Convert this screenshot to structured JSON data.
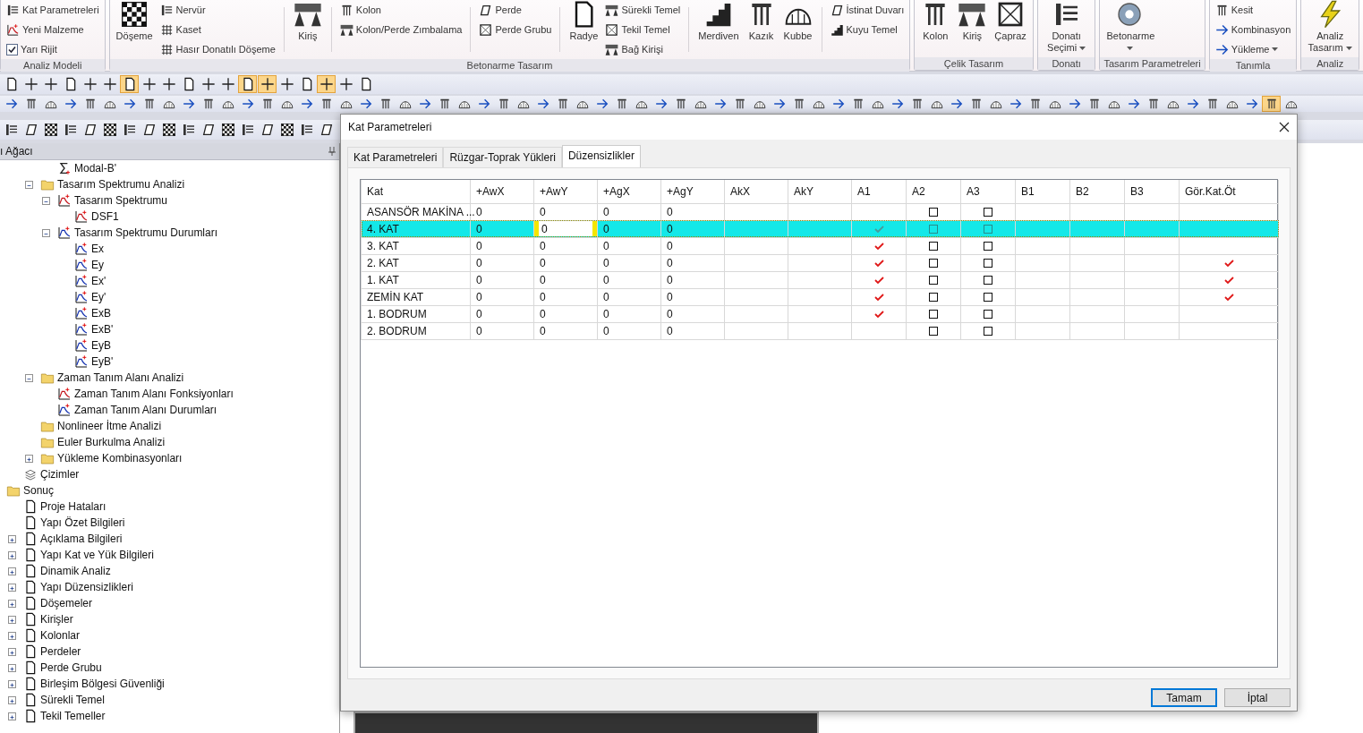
{
  "ribbon": {
    "groups": [
      {
        "label": "Analiz Modeli",
        "items": [
          {
            "kind": "stack",
            "items": [
              {
                "label": "Kat Parametreleri"
              },
              {
                "label": "Yeni Malzeme"
              },
              {
                "label": "Yarı Rijit",
                "checked": true
              }
            ]
          }
        ]
      },
      {
        "label": "Betonarme Tasarım",
        "items": [
          {
            "kind": "large",
            "label": "Döşeme"
          },
          {
            "kind": "stack",
            "items": [
              {
                "label": "Nervür"
              },
              {
                "label": "Kaset"
              },
              {
                "label": "Hasır Donatılı Döşeme"
              }
            ]
          },
          {
            "kind": "separator"
          },
          {
            "kind": "large",
            "label": "Kiriş"
          },
          {
            "kind": "separator"
          },
          {
            "kind": "stack",
            "items": [
              {
                "label": "Kolon"
              },
              {
                "label": "Kolon/Perde Zımbalama"
              }
            ]
          },
          {
            "kind": "separator"
          },
          {
            "kind": "stack",
            "items": [
              {
                "label": "Perde"
              },
              {
                "label": "Perde Grubu"
              }
            ]
          },
          {
            "kind": "separator"
          },
          {
            "kind": "large",
            "label": "Radye"
          },
          {
            "kind": "stack",
            "items": [
              {
                "label": "Sürekli Temel"
              },
              {
                "label": "Tekil Temel"
              },
              {
                "label": "Bağ Kirişi"
              }
            ]
          },
          {
            "kind": "separator"
          },
          {
            "kind": "large",
            "label": "Merdiven"
          },
          {
            "kind": "large",
            "label": "Kazık"
          },
          {
            "kind": "large",
            "label": "Kubbe"
          },
          {
            "kind": "separator"
          },
          {
            "kind": "stack",
            "items": [
              {
                "label": "İstinat Duvarı"
              },
              {
                "label": "Kuyu Temel"
              }
            ]
          }
        ]
      },
      {
        "label": "Çelik Tasarım",
        "items": [
          {
            "kind": "large",
            "label": "Kolon"
          },
          {
            "kind": "large",
            "label": "Kiriş"
          },
          {
            "kind": "large",
            "label": "Çapraz"
          }
        ]
      },
      {
        "label": "Donatı",
        "items": [
          {
            "kind": "large",
            "label": "Donatı Seçimi",
            "dropdown": true
          }
        ]
      },
      {
        "label": "Tasarım Parametreleri",
        "items": [
          {
            "kind": "large",
            "label": "Betonarme",
            "dropdown": true
          }
        ]
      },
      {
        "label": "Tanımla",
        "items": [
          {
            "kind": "stack",
            "items": [
              {
                "label": "Kesit"
              },
              {
                "label": "Kombinasyon"
              },
              {
                "label": "Yükleme",
                "dropdown": true
              }
            ]
          }
        ]
      },
      {
        "label": "Analiz",
        "items": [
          {
            "kind": "large",
            "label": "Analiz Tasarım",
            "dropdown": true
          }
        ]
      }
    ]
  },
  "toolbars": [
    {
      "buttons": [
        {
          "selected": false
        },
        {
          "selected": false
        },
        {
          "selected": false
        },
        {
          "selected": false
        },
        {
          "selected": false
        },
        {
          "selected": false
        },
        {
          "selected": true
        },
        {
          "selected": false
        },
        {
          "selected": false
        },
        {
          "selected": false
        },
        {
          "selected": false
        },
        {
          "selected": false
        },
        {
          "selected": true
        },
        {
          "selected": true
        },
        {
          "selected": false
        },
        {
          "selected": false
        },
        {
          "selected": true
        },
        {
          "selected": false
        },
        {
          "selected": false
        }
      ]
    },
    {
      "buttons": [
        {
          "selected": false
        },
        {
          "selected": false
        },
        {
          "selected": false
        },
        {
          "selected": false
        },
        {
          "selected": false
        },
        {
          "selected": false
        },
        {
          "selected": false
        },
        {
          "selected": false
        },
        {
          "selected": false
        },
        {
          "selected": false
        },
        {
          "selected": false
        },
        {
          "selected": false
        },
        {
          "selected": false
        },
        {
          "selected": false
        },
        {
          "selected": false
        },
        {
          "selected": false
        },
        {
          "selected": false
        },
        {
          "selected": false
        },
        {
          "selected": false
        },
        {
          "selected": false
        },
        {
          "selected": false
        },
        {
          "selected": false
        },
        {
          "selected": false
        },
        {
          "selected": false
        },
        {
          "selected": false
        },
        {
          "selected": false
        },
        {
          "selected": false
        },
        {
          "selected": false
        },
        {
          "selected": false
        },
        {
          "selected": false
        },
        {
          "selected": false
        },
        {
          "selected": false
        },
        {
          "selected": false
        },
        {
          "selected": false
        },
        {
          "selected": false
        },
        {
          "selected": false
        },
        {
          "selected": false
        },
        {
          "selected": false
        },
        {
          "selected": false
        },
        {
          "selected": false
        },
        {
          "selected": false
        },
        {
          "selected": false
        },
        {
          "selected": false
        },
        {
          "selected": false
        },
        {
          "selected": false
        },
        {
          "selected": false
        },
        {
          "selected": false
        },
        {
          "selected": false
        },
        {
          "selected": false
        },
        {
          "selected": false
        },
        {
          "selected": false
        },
        {
          "selected": false
        },
        {
          "selected": false
        },
        {
          "selected": false
        },
        {
          "selected": false
        },
        {
          "selected": false
        },
        {
          "selected": false
        },
        {
          "selected": false
        },
        {
          "selected": false
        },
        {
          "selected": false
        },
        {
          "selected": false
        },
        {
          "selected": false
        },
        {
          "selected": false
        },
        {
          "selected": false
        },
        {
          "selected": true
        },
        {
          "selected": false
        }
      ]
    },
    {
      "buttons": [
        {
          "selected": false
        },
        {
          "selected": false
        },
        {
          "selected": false
        },
        {
          "selected": false
        },
        {
          "selected": false
        },
        {
          "selected": false
        },
        {
          "selected": false
        },
        {
          "selected": false
        },
        {
          "selected": false
        },
        {
          "selected": false
        },
        {
          "selected": false
        },
        {
          "selected": false
        },
        {
          "selected": false
        },
        {
          "selected": false
        },
        {
          "selected": false
        },
        {
          "selected": false
        },
        {
          "selected": false
        }
      ]
    }
  ],
  "tree_panel": {
    "title": "ı Ağacı",
    "tree": [
      {
        "children": [
          {
            "children": [
              {
                "children": [
                  {
                    "label": "Modal-B'",
                    "kind": "sum"
                  }
                ]
              },
              {
                "label": "Tasarım Spektrumu Analizi",
                "kind": "folder",
                "expanded": true,
                "children": [
                  {
                    "label": "Tasarım Spektrumu",
                    "kind": "function",
                    "expanded": true,
                    "children": [
                      {
                        "label": "DSF1",
                        "kind": "function"
                      }
                    ]
                  },
                  {
                    "label": "Tasarım Spektrumu Durumları",
                    "kind": "case",
                    "expanded": true,
                    "children": [
                      {
                        "label": "Ex",
                        "kind": "case"
                      },
                      {
                        "label": "Ey",
                        "kind": "case"
                      },
                      {
                        "label": "Ex'",
                        "kind": "case"
                      },
                      {
                        "label": "Ey'",
                        "kind": "case"
                      },
                      {
                        "label": "ExB",
                        "kind": "case"
                      },
                      {
                        "label": "ExB'",
                        "kind": "case"
                      },
                      {
                        "label": "EyB",
                        "kind": "case"
                      },
                      {
                        "label": "EyB'",
                        "kind": "case"
                      }
                    ]
                  }
                ]
              },
              {
                "label": "Zaman Tanım Alanı Analizi",
                "kind": "folder",
                "expanded": true,
                "children": [
                  {
                    "label": "Zaman Tanım Alanı Fonksiyonları",
                    "kind": "function"
                  },
                  {
                    "label": "Zaman Tanım Alanı Durumları",
                    "kind": "case"
                  }
                ]
              },
              {
                "label": "Nonlineer İtme Analizi",
                "kind": "folder"
              },
              {
                "label": "Euler Burkulma Analizi",
                "kind": "folder"
              },
              {
                "label": "Yükleme Kombinasyonları",
                "kind": "folder",
                "expanded": false
              }
            ]
          },
          {
            "label": "Çizimler",
            "kind": "drawings"
          }
        ]
      },
      {
        "label": "Sonuç",
        "kind": "folder",
        "children": [
          {
            "label": "Proje Hataları",
            "kind": "page"
          },
          {
            "label": "Yapı Özet Bilgileri",
            "kind": "page"
          },
          {
            "label": "Açıklama Bilgileri",
            "kind": "page",
            "expanded": false
          },
          {
            "label": "Yapı Kat ve Yük Bilgileri",
            "kind": "page",
            "expanded": false
          },
          {
            "label": "Dinamik Analiz",
            "kind": "page",
            "expanded": false
          },
          {
            "label": "Yapı Düzensizlikleri",
            "kind": "page",
            "expanded": false
          },
          {
            "label": "Döşemeler",
            "kind": "page",
            "expanded": false
          },
          {
            "label": "Kirişler",
            "kind": "page",
            "expanded": false
          },
          {
            "label": "Kolonlar",
            "kind": "page",
            "expanded": false
          },
          {
            "label": "Perdeler",
            "kind": "page",
            "expanded": false
          },
          {
            "label": "Perde Grubu",
            "kind": "page",
            "expanded": false
          },
          {
            "label": "Birleşim Bölgesi Güvenliği",
            "kind": "page",
            "expanded": false
          },
          {
            "label": "Sürekli Temel",
            "kind": "page",
            "expanded": false
          },
          {
            "label": "Tekil Temeller",
            "kind": "page",
            "expanded": false
          }
        ]
      }
    ]
  },
  "dialog": {
    "title": "Kat Parametreleri",
    "tabs": [
      {
        "label": "Kat Parametreleri",
        "selected": false
      },
      {
        "label": "Rüzgar-Toprak Yükleri",
        "selected": false
      },
      {
        "label": "Düzensizlikler",
        "selected": true
      }
    ],
    "table": {
      "columns": [
        {
          "label": "Kat",
          "kind": "text"
        },
        {
          "label": "+AwX",
          "kind": "text"
        },
        {
          "label": "+AwY",
          "kind": "text"
        },
        {
          "label": "+AgX",
          "kind": "text"
        },
        {
          "label": "+AgY",
          "kind": "text"
        },
        {
          "label": "AkX",
          "kind": "text"
        },
        {
          "label": "AkY",
          "kind": "text"
        },
        {
          "label": "A1",
          "kind": "tick"
        },
        {
          "label": "A2",
          "kind": "box"
        },
        {
          "label": "A3",
          "kind": "box"
        },
        {
          "label": "B1",
          "kind": "text"
        },
        {
          "label": "B2",
          "kind": "text"
        },
        {
          "label": "B3",
          "kind": "text"
        },
        {
          "label": "Gör.Kat.Öt",
          "kind": "tick"
        }
      ],
      "rows": [
        {
          "selected": false,
          "cells": [
            "ASANSÖR MAKİNA ...",
            "0",
            "0",
            "0",
            "0",
            null,
            null,
            false,
            false,
            false,
            null,
            null,
            null,
            false
          ]
        },
        {
          "selected": true,
          "cells": [
            "4. KAT",
            "0",
            {
              "value": "0",
              "editing": true
            },
            "0",
            "0",
            null,
            null,
            true,
            false,
            false,
            null,
            null,
            null,
            false
          ]
        },
        {
          "selected": false,
          "cells": [
            "3. KAT",
            "0",
            "0",
            "0",
            "0",
            null,
            null,
            true,
            false,
            false,
            null,
            null,
            null,
            false
          ]
        },
        {
          "selected": false,
          "cells": [
            "2. KAT",
            "0",
            "0",
            "0",
            "0",
            null,
            null,
            true,
            false,
            false,
            null,
            null,
            null,
            true
          ]
        },
        {
          "selected": false,
          "cells": [
            "1. KAT",
            "0",
            "0",
            "0",
            "0",
            null,
            null,
            true,
            false,
            false,
            null,
            null,
            null,
            true
          ]
        },
        {
          "selected": false,
          "cells": [
            "ZEMİN KAT",
            "0",
            "0",
            "0",
            "0",
            null,
            null,
            true,
            false,
            false,
            null,
            null,
            null,
            true
          ]
        },
        {
          "selected": false,
          "cells": [
            "1. BODRUM",
            "0",
            "0",
            "0",
            "0",
            null,
            null,
            true,
            false,
            false,
            null,
            null,
            null,
            false
          ]
        },
        {
          "selected": false,
          "cells": [
            "2. BODRUM",
            "0",
            "0",
            "0",
            "0",
            null,
            null,
            false,
            false,
            false,
            null,
            null,
            null,
            false
          ]
        }
      ]
    },
    "buttons": [
      {
        "label": "Tamam",
        "default": true
      },
      {
        "label": "İptal",
        "default": false
      }
    ]
  }
}
